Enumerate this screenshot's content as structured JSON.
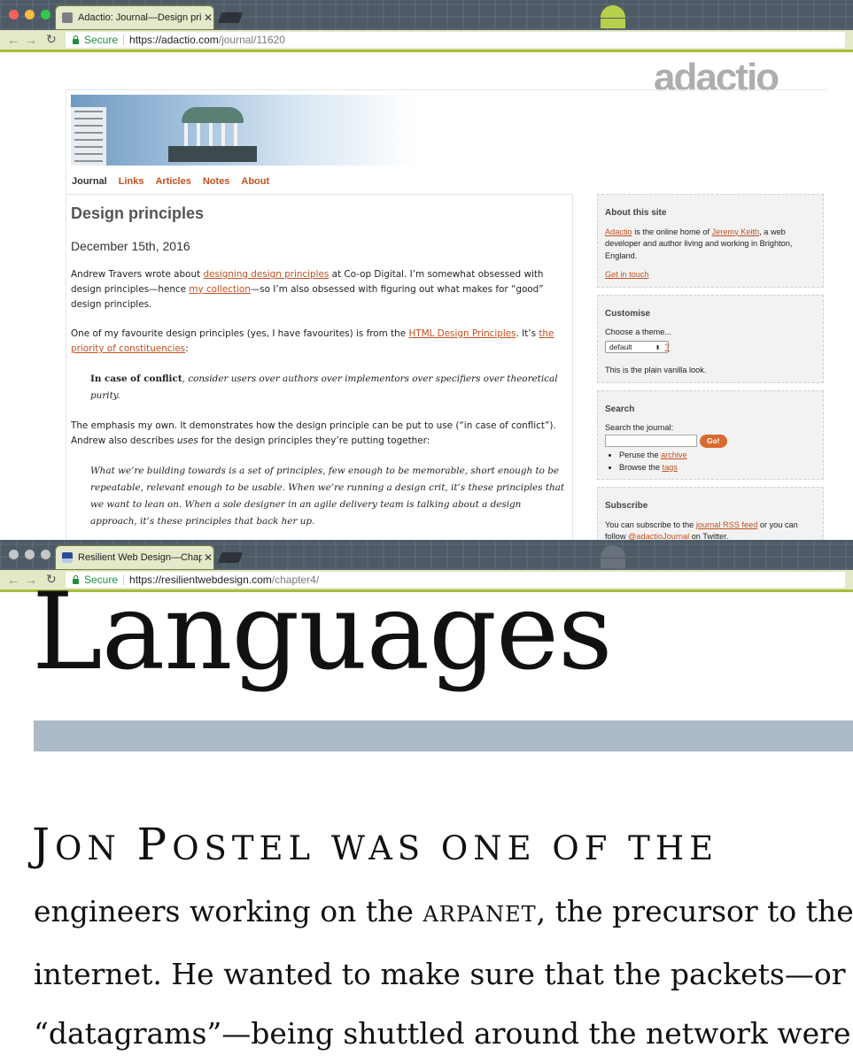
{
  "window1": {
    "tab_title": "Adactio: Journal—Design princ",
    "close_glyph": "✕",
    "secure_label": "Secure",
    "url_host": "https://adactio.com",
    "url_path": "/journal/11620"
  },
  "adactio": {
    "logo": "adactio",
    "nav": [
      "Journal",
      "Links",
      "Articles",
      "Notes",
      "About"
    ],
    "title": "Design principles",
    "date": "December 15th, 2016",
    "p1": {
      "t1": "Andrew Travers wrote about ",
      "link1": "designing design principles",
      "t2": " at Co-op Digital. I’m somewhat obsessed with design principles—hence ",
      "link2": "my collection",
      "t3": "—so I’m also obsessed with figuring out what makes for “good” design principles."
    },
    "p2": {
      "t1": "One of my favourite design principles (yes, I have favourites) is from the ",
      "link1": "HTML Design Principles",
      "t2": ". It’s ",
      "link2": "the priority of constituencies",
      "t3": ":"
    },
    "quote1": {
      "bold": "In case of conflict",
      "rest": ", consider users over authors over implementors over specifiers over theoretical purity."
    },
    "p3": {
      "t1": "The emphasis my own. It demonstrates how the design principle can be put to use (“in case of conflict”). Andrew also describes ",
      "em": "uses",
      "t2": " for the design principles they’re putting together:"
    },
    "quote2": "What we’re building towards is a set of principles, few enough to be memorable, short enough to be repeatable, relevant enough to be usable. When we’re running a design crit, it’s these principles that we want to lean on. When a sole designer in an agile delivery team is talking about a design approach, it’s these principles that back her up.",
    "sidebar": {
      "about_heading": "About this site",
      "about_link1": "Adactio",
      "about_t1": " is the online home of ",
      "about_link2": "Jeremy Keith",
      "about_t2": ", a web developer and author living and working in Brighton, England.",
      "about_contact": "Get in touch",
      "customise_heading": "Customise",
      "theme_label": "Choose a theme...",
      "theme_value": "default",
      "theme_help": "?",
      "theme_note": "This is the plain vanilla look.",
      "search_heading": "Search",
      "search_label": "Search the journal:",
      "search_button": "Go!",
      "peruse_t": "Peruse the ",
      "peruse_link": "archive",
      "browse_t": "Browse the ",
      "browse_link": "tags",
      "subscribe_heading": "Subscribe",
      "subscribe_t1": "You can subscribe to the ",
      "subscribe_link1": "journal RSS feed",
      "subscribe_t2": " or you can follow ",
      "subscribe_link2": "@adactioJournal",
      "subscribe_t3": " on Twitter."
    }
  },
  "window2": {
    "tab_title": "Resilient Web Design—Chapte",
    "close_glyph": "✕",
    "secure_label": "Secure",
    "url_host": "https://resilientwebdesign.com",
    "url_path": "/chapter4/"
  },
  "resilient": {
    "chapter_title": "Languages",
    "lead_j": "J",
    "lead_on": "ON ",
    "lead_p": "P",
    "lead_rest": "OSTEL WAS ONE OF THE",
    "line1_a": "engineers working on the ",
    "line1_sc": "ARPANET",
    "line1_b": ", the precursor to the",
    "line2": "internet. He wanted to make sure that the packets—or",
    "line3": "“datagrams”—being shuttled around the network were"
  },
  "colors": {
    "link": "#c4501f",
    "divider": "#adbac8",
    "toolbar": "#e3e8c6",
    "accent_green": "#a9bb3c"
  }
}
